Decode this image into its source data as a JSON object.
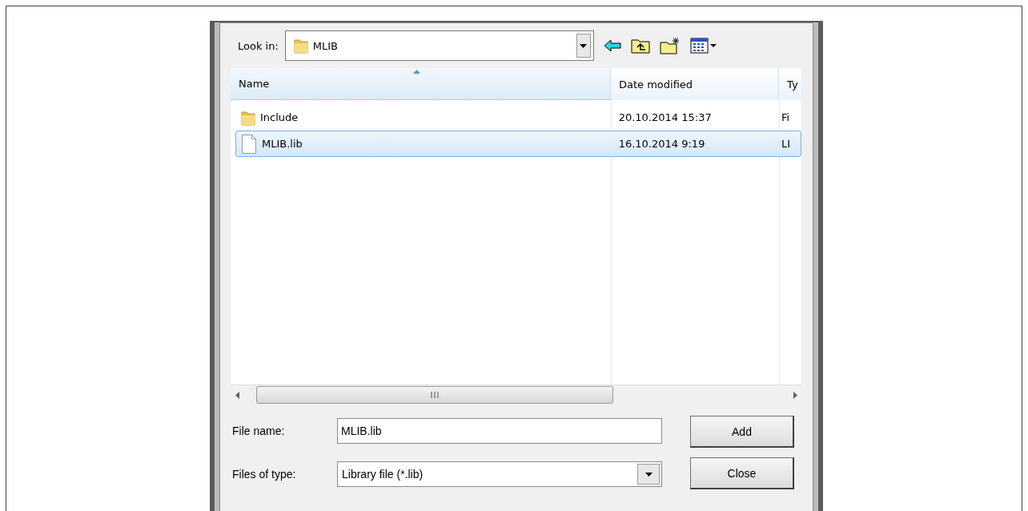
{
  "look_in": {
    "label": "Look in:",
    "value": "MLIB"
  },
  "columns": [
    {
      "label": "Name",
      "sorted": true
    },
    {
      "label": "Date modified",
      "sorted": false
    },
    {
      "label": "Ty",
      "sorted": false
    }
  ],
  "rows": [
    {
      "kind": "folder",
      "name": "Include",
      "date": "20.10.2014 15:37",
      "type": "Fi",
      "selected": false
    },
    {
      "kind": "file",
      "name": "MLIB.lib",
      "date": "16.10.2014 9:19",
      "type": "LI",
      "selected": true
    }
  ],
  "file_name": {
    "label": "File name:",
    "value": "MLIB.lib"
  },
  "files_of_type": {
    "label": "Files of type:",
    "value": "Library file (*.lib)"
  },
  "buttons": [
    "Add",
    "Close"
  ]
}
